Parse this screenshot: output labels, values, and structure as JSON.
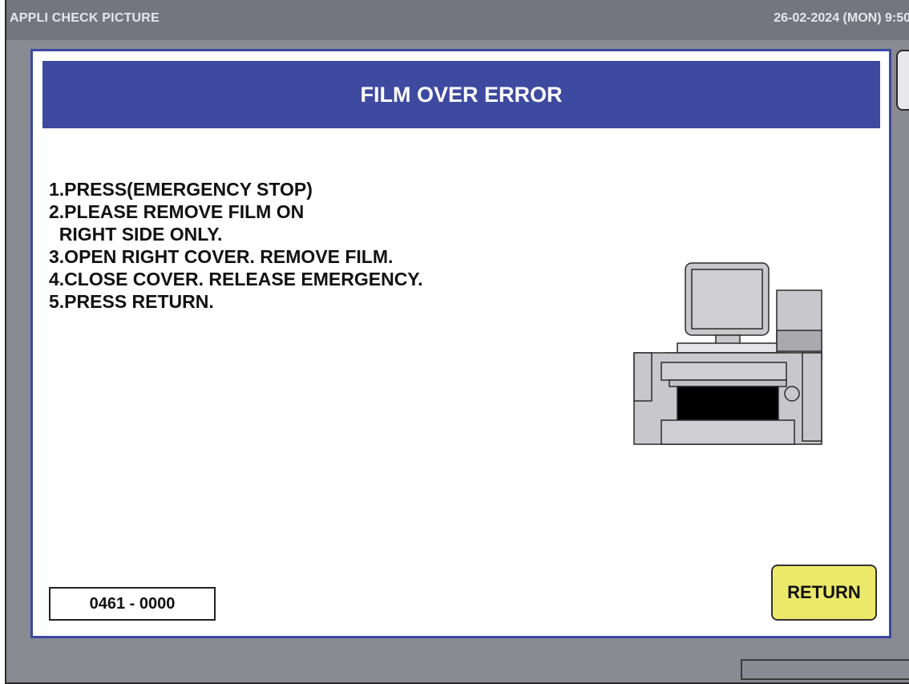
{
  "titlebar": {
    "app_title": "APPLI CHECK PICTURE",
    "datetime": "26-02-2024 (MON)  9:50"
  },
  "dialog": {
    "title": "FILM OVER ERROR",
    "instructions": [
      "1.PRESS(EMERGENCY STOP)",
      "2.PLEASE REMOVE FILM ON",
      "  RIGHT SIDE ONLY.",
      "3.OPEN RIGHT COVER. REMOVE FILM.",
      "4.CLOSE COVER. RELEASE EMERGENCY.",
      "5.PRESS RETURN."
    ],
    "error_code": "0461 - 0000",
    "return_label": "RETURN",
    "machine_icon": "wrapping-machine-icon"
  },
  "colors": {
    "header_bg": "#3e4aa0",
    "return_bg": "#ece96a",
    "screen_bg": "#8a8a92"
  }
}
